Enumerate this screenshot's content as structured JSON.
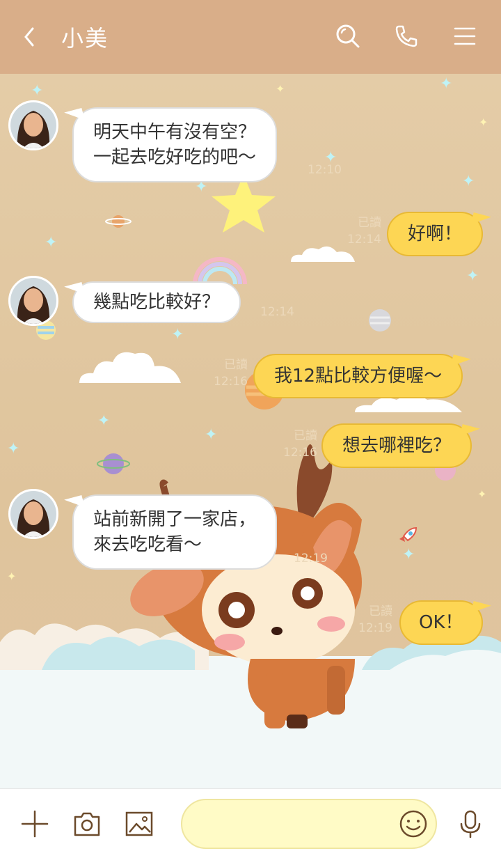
{
  "header": {
    "title": "小美",
    "icons": [
      "back-icon",
      "search-icon",
      "phone-icon",
      "menu-icon"
    ]
  },
  "messages": [
    {
      "side": "in",
      "text_lines": [
        "明天中午有沒有空？",
        "一起去吃好吃的吧～"
      ],
      "time": "12:10"
    },
    {
      "side": "out",
      "text": "好啊！",
      "read": "已讀",
      "time": "12:14"
    },
    {
      "side": "in",
      "text": "幾點吃比較好？",
      "time": "12:14"
    },
    {
      "side": "out",
      "text": "我12點比較方便喔～",
      "read": "已讀",
      "time": "12:16"
    },
    {
      "side": "out",
      "text": "想去哪裡吃？",
      "read": "已讀",
      "time": "12:16"
    },
    {
      "side": "in",
      "text_lines": [
        "站前新開了一家店，",
        "來去吃吃看～"
      ],
      "time": "12:19"
    },
    {
      "side": "out",
      "text": "OK！",
      "read": "已讀",
      "time": "12:19"
    }
  ],
  "bottom": {
    "icons": [
      "plus-icon",
      "camera-icon",
      "image-icon",
      "smile-icon",
      "mic-icon"
    ],
    "input_value": ""
  },
  "colors": {
    "header_bg": "#d9ae89",
    "chat_bg": "#e2c9a3",
    "bubble_out": "#fdd654",
    "bubble_in": "#ffffff"
  }
}
